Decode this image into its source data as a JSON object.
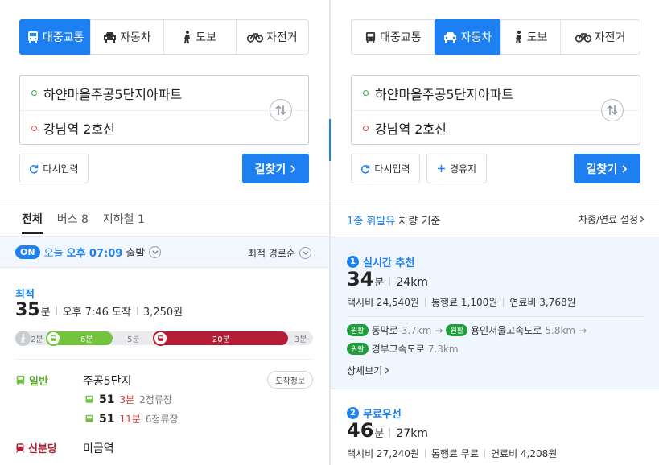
{
  "modes": [
    {
      "label": "대중교통",
      "icon": "bus-icon"
    },
    {
      "label": "자동차",
      "icon": "car-icon"
    },
    {
      "label": "도보",
      "icon": "walk-icon"
    },
    {
      "label": "자전거",
      "icon": "bicycle-icon"
    }
  ],
  "origin": "하얀마을주공5단지아파트",
  "destination": "강남역 2호선",
  "buttons": {
    "reset": "다시입력",
    "waypoint": "경유지",
    "find": "길찾기"
  },
  "left": {
    "tabs": [
      "전체",
      "버스 8",
      "지하철 1"
    ],
    "depart": {
      "on": "ON",
      "day": "오늘",
      "time": "오후 07:09",
      "suffix": "출발",
      "sort": "최적 경로순"
    },
    "route": {
      "badge": "최적",
      "duration": "35",
      "duration_unit": "분",
      "arrival": "오후 7:46 도착",
      "fare": "3,250원",
      "bar": {
        "walk1": "2분",
        "bus": "6분",
        "walk2": "5분",
        "subway": "20분",
        "walk3": "3분",
        "minutes": {
          "walk1": 2,
          "bus": 6,
          "walk2": 5,
          "subway": 20,
          "walk3": 3
        }
      },
      "steps": [
        {
          "type": "일반",
          "place": "주공5단지",
          "arrival_btn": "도착정보",
          "buses": [
            {
              "no": "51",
              "eta": "3분",
              "stops": "2정류장"
            },
            {
              "no": "51",
              "eta": "11분",
              "stops": "6정류장"
            }
          ]
        },
        {
          "type": "신분당",
          "place": "미금역"
        }
      ]
    }
  },
  "right": {
    "fuel_type": "1종 휘발유",
    "fuel_suffix": "차량 기준",
    "settings": "차종/연료 설정",
    "options": [
      {
        "no": "1",
        "title": "실시간 추천",
        "minutes": "34",
        "unit": "분",
        "distance": "24km",
        "taxi": "택시비 24,540원",
        "toll": "통행료 1,100원",
        "fuel": "연료비 3,768원",
        "roads": [
          {
            "pill": "원활",
            "name": "동막로",
            "dist": "3.7km"
          },
          {
            "pill": "원활",
            "name": "용인서울고속도로",
            "dist": "5.8km"
          },
          {
            "pill": "원활",
            "name": "경부고속도로",
            "dist": "7.3km"
          }
        ],
        "detail": "상세보기"
      },
      {
        "no": "2",
        "title": "무료우선",
        "minutes": "46",
        "unit": "분",
        "distance": "27km",
        "taxi": "택시비 27,240원",
        "toll": "통행료 무료",
        "fuel": "연료비 4,208원"
      }
    ]
  },
  "colors": {
    "accent": "#1e80f0",
    "bus": "#74c33f",
    "subway": "#b31d36",
    "green": "#1f9e3c",
    "red": "#e2353a"
  }
}
